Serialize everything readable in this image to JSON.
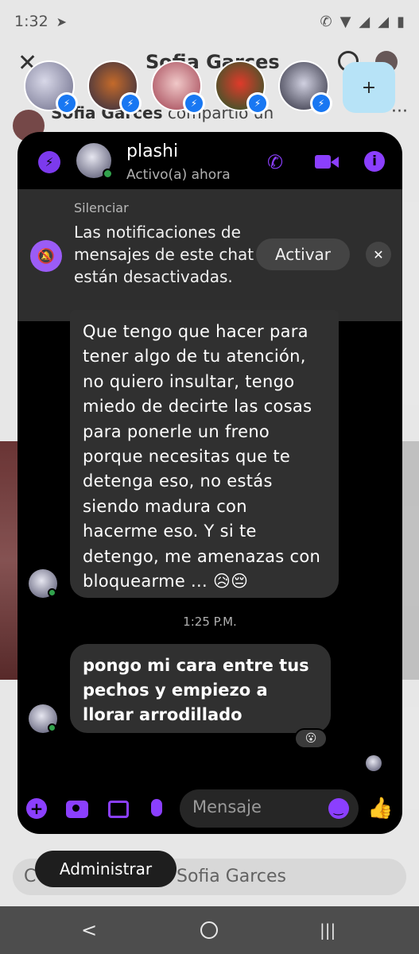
{
  "status_bar": {
    "time": "1:32",
    "left_icon": "telegram-icon",
    "right_icons": [
      "call-icon",
      "wifi-icon",
      "signal-icon",
      "battery-icon"
    ]
  },
  "background": {
    "title": "Sofia Garces",
    "post_author": "Sofia Garces",
    "post_text": "compartió un",
    "bottom_text": "Sofia Garces",
    "bottom_prefix": "C"
  },
  "chat_heads": [
    {
      "name": "head-1"
    },
    {
      "name": "head-2"
    },
    {
      "name": "head-3"
    },
    {
      "name": "head-4"
    },
    {
      "name": "head-5"
    }
  ],
  "add_head_label": "+",
  "chat": {
    "name": "plashi",
    "status": "Activo(a) ahora",
    "mute_banner": {
      "heading": "Silenciar",
      "text": "Las notificaciones de mensajes de este chat están desactivadas.",
      "button": "Activar",
      "close": "✕"
    },
    "messages": [
      {
        "text": "Que tengo que hacer para tener algo de tu atención, no quiero insultar, tengo miedo de decirte las cosas para ponerle un freno porque necesitas que te detenga eso, no estás siendo madura con hacerme eso. Y si te detengo, me amenazas con bloquearme ... 😥😔"
      },
      {
        "text": "pongo mi cara entre tus pechos y empiezo a llorar arrodillado"
      }
    ],
    "time_separator": "1:25 P.M.",
    "reaction": "😮",
    "composer_placeholder": "Mensaje"
  },
  "admin_pill": "Administrar",
  "nav": {
    "back": "<",
    "recent": "|||"
  },
  "colors": {
    "accent": "#8b3ffe",
    "bubble": "#303030",
    "panel": "#000000"
  }
}
